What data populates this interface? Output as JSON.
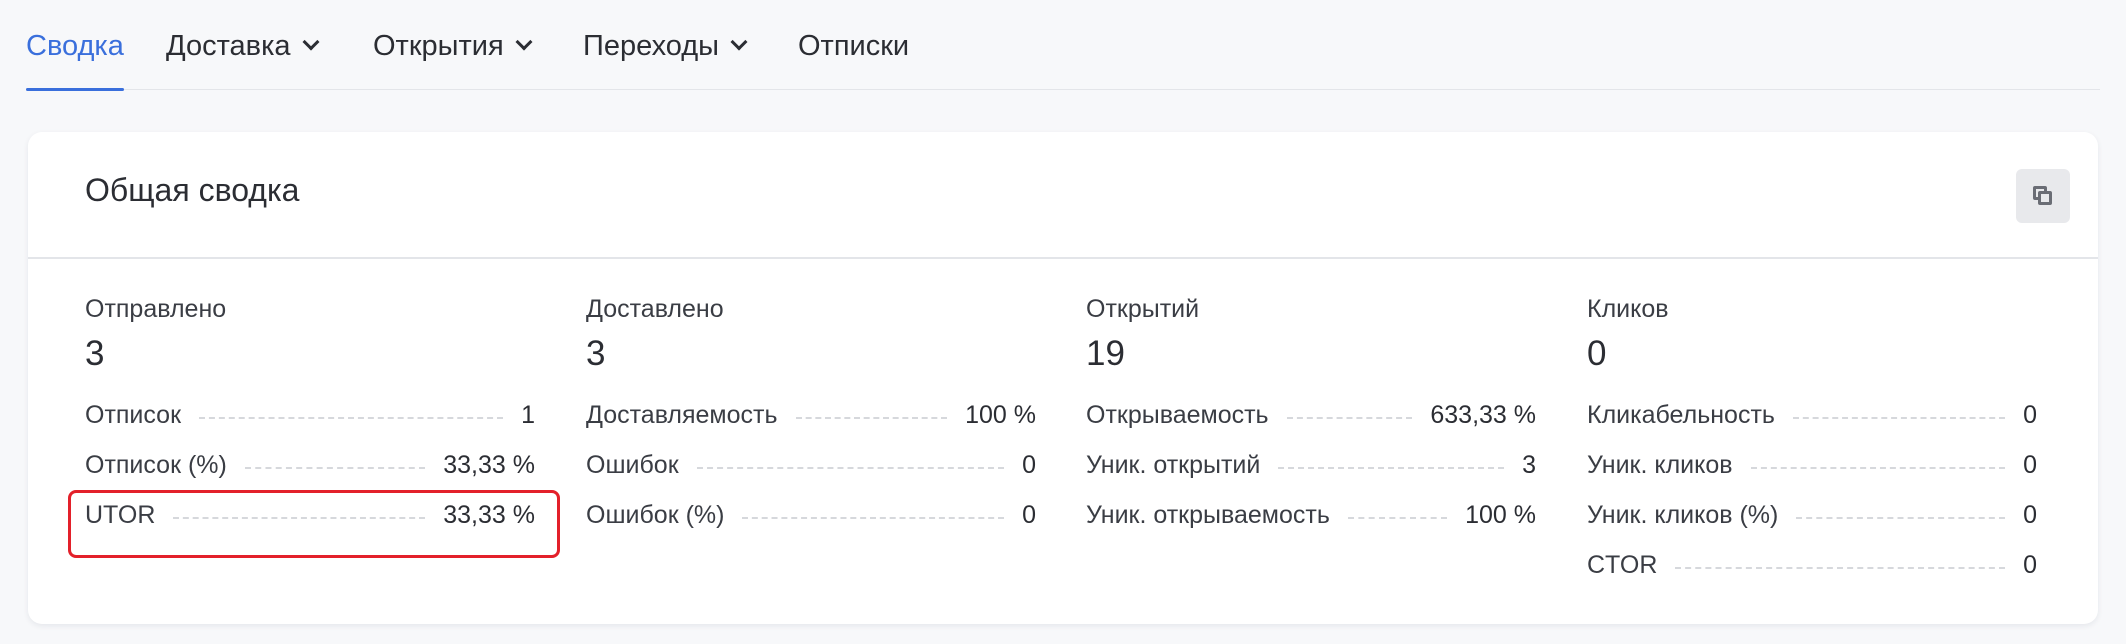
{
  "tabs": [
    {
      "label": "Сводка",
      "active": true
    },
    {
      "label": "Доставка",
      "dropdown": true
    },
    {
      "label": "Открытия",
      "dropdown": true
    },
    {
      "label": "Переходы",
      "dropdown": true
    },
    {
      "label": "Отписки"
    }
  ],
  "card": {
    "title": "Общая сводка",
    "copy_icon": "copy-icon"
  },
  "columns": [
    {
      "label": "Отправлено",
      "value": "3",
      "rows": [
        {
          "label": "Отписок",
          "value": "1"
        },
        {
          "label": "Отписок (%)",
          "value": "33,33 %"
        },
        {
          "label": "UTOR",
          "value": "33,33 %"
        }
      ]
    },
    {
      "label": "Доставлено",
      "value": "3",
      "rows": [
        {
          "label": "Доставляемость",
          "value": "100 %"
        },
        {
          "label": "Ошибок",
          "value": "0"
        },
        {
          "label": "Ошибок (%)",
          "value": "0"
        }
      ]
    },
    {
      "label": "Открытий",
      "value": "19",
      "rows": [
        {
          "label": "Открываемость",
          "value": "633,33 %"
        },
        {
          "label": "Уник. открытий",
          "value": "3"
        },
        {
          "label": "Уник. открываемость",
          "value": "100 %"
        }
      ]
    },
    {
      "label": "Кликов",
      "value": "0",
      "rows": [
        {
          "label": "Кликабельность",
          "value": "0"
        },
        {
          "label": "Уник. кликов",
          "value": "0"
        },
        {
          "label": "Уник. кликов (%)",
          "value": "0"
        },
        {
          "label": "CTOR",
          "value": "0"
        }
      ]
    }
  ],
  "colors": {
    "accent": "#3a6fdc",
    "highlight": "#e3202a"
  }
}
